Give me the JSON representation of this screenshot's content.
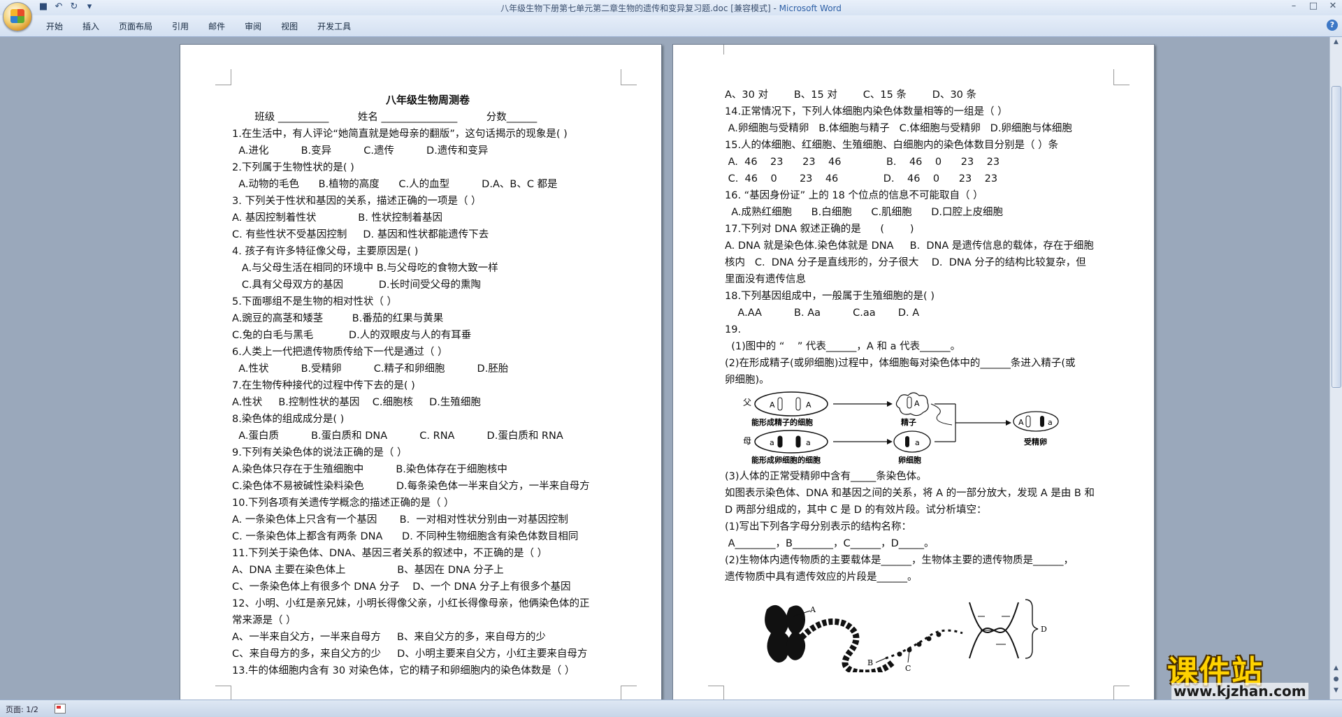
{
  "window": {
    "title": "八年级生物下册第七单元第二章生物的遗传和变异复习题.doc [兼容模式]",
    "title_sep": " - ",
    "app_name": "Microsoft Word"
  },
  "ribbon": {
    "tabs": [
      "开始",
      "插入",
      "页面布局",
      "引用",
      "邮件",
      "审阅",
      "视图",
      "开发工具"
    ]
  },
  "left_page": {
    "title": "八年级生物周测卷",
    "lines": [
      "       班级 __________         姓名 _______________         分数______",
      "1.在生活中，有人评论“她简直就是她母亲的翻版”，这句话揭示的现象是(      )",
      "  A.进化          B.变异          C.遗传          D.遗传和变异",
      "2.下列属于生物性状的是(      )",
      "  A.动物的毛色      B.植物的高度      C.人的血型          D.A、B、C 都是",
      "3. 下列关于性状和基因的关系，描述正确的一项是（   ）",
      "A. 基因控制着性状             B. 性状控制着基因",
      "C. 有些性状不受基因控制     D. 基因和性状都能遗传下去",
      "4. 孩子有许多特征像父母，主要原因是(      )",
      "   A.与父母生活在相同的环境中 B.与父母吃的食物大致一样",
      "   C.具有父母双方的基因           D.长时间受父母的熏陶",
      "5.下面哪组不是生物的相对性状（      ）",
      "A.豌豆的高茎和矮茎         B.番茄的红果与黄果",
      "C.兔的白毛与黑毛           D.人的双眼皮与人的有耳垂",
      "6.人类上一代把遗传物质传给下一代是通过（        ）",
      "  A.性状          B.受精卵          C.精子和卵细胞          D.胚胎",
      "7.在生物传种接代的过程中传下去的是(      )",
      "A.性状     B.控制性状的基因    C.细胞核     D.生殖细胞",
      "8.染色体的组成成分是(      )",
      "  A.蛋白质          B.蛋白质和 DNA          C. RNA          D.蛋白质和 RNA",
      "9.下列有关染色体的说法正确的是（       ）",
      "A.染色体只存在于生殖细胞中          B.染色体存在于细胞核中",
      "C.染色体不易被碱性染料染色          D.每条染色体一半来自父方，一半来自母方",
      "10.下列各项有关遗传学概念的描述正确的是（        ）",
      "A. 一条染色体上只含有一个基因       B.  一对相对性状分别由一对基因控制",
      "C. 一条染色体上都含有两条 DNA      D. 不同种生物细胞含有染色体数目相同",
      "11.下列关于染色体、DNA、基因三者关系的叙述中，不正确的是（        ）",
      "A、DNA 主要在染色体上                B、基因在 DNA 分子上",
      "C、一条染色体上有很多个 DNA 分子    D、一个 DNA 分子上有很多个基因",
      "12、小明、小红是亲兄妹，小明长得像父亲，小红长得像母亲，他俩染色体的正",
      "常来源是（       ）",
      "A、一半来自父方，一半来自母方     B、来自父方的多，来自母方的少",
      "C、来自母方的多，来自父方的少     D、小明主要来自父方，小红主要来自母方",
      "13.牛的体细胞内含有 30 对染色体，它的精子和卵细胞内的染色体数是（        ）"
    ]
  },
  "right_page": {
    "lines_top": [
      "A、30 对        B、15 对        C、15 条        D、30 条",
      "14.正常情况下，下列人体细胞内染色体数量相等的一组是（        ）",
      " A.卵细胞与受精卵   B.体细胞与精子   C.体细胞与受精卵   D.卵细胞与体细胞",
      "15.人的体细胞、红细胞、生殖细胞、白细胞内的染色体数目分别是（      ）条",
      " A.  46    23      23    46              B.    46    0      23    23",
      " C.  46    0       23    46              D.    46    0      23    23",
      "16. “基因身份证” 上的 18 个位点的信息不可能取自（      ）",
      "  A.成熟红细胞      B.白细胞      C.肌细胞      D.口腔上皮细胞",
      "17.下列对 DNA 叙述正确的是      (        )",
      "A. DNA 就是染色体.染色体就是 DNA     B.  DNA 是遗传信息的载体，存在于细胞",
      "核内   C.  DNA 分子是直线形的，分子很大    D.  DNA 分子的结构比较复杂，但",
      "里面没有遗传信息",
      "18.下列基因组成中，一般属于生殖细胞的是(      )",
      "    A.AA          B. Aa          C.aa       D. A",
      "19.",
      "  (1)图中的 “    ” 代表______，A 和 a 代表______。",
      "(2)在形成精子(或卵细胞)过程中，体细胞每对染色体中的______条进入精子(或",
      "卵细胞)。"
    ],
    "lines_bottom": [
      "(3)人体的正常受精卵中含有_____条染色体。",
      "如图表示染色体、DNA 和基因之间的关系，将 A 的一部分放大，发现 A 是由 B 和",
      "D 两部分组成的，其中 C 是 D 的有效片段。试分析填空：",
      "(1)写出下列各字母分别表示的结构名称：",
      " A________，B________，C______，D_____。",
      "(2)生物体内遗传物质的主要载体是______，生物体主要的遗传物质是______，",
      "遗传物质中具有遗传效应的片段是______。"
    ],
    "inheritance_diagram": {
      "father_label": "父",
      "mother_label": "母",
      "sperm_cell_label": "能形成精子的细胞",
      "egg_cell_label": "能形成卵细胞的细胞",
      "sperm_label": "精子",
      "egg_label": "卵细胞",
      "zygote_label": "受精卵",
      "allele_A": "A",
      "allele_a": "a"
    },
    "chromosome_figure": {
      "label_A": "A",
      "label_B": "B",
      "label_C": "C",
      "label_D": "D"
    }
  },
  "status": {
    "page": "页面: 1/2"
  },
  "watermark": {
    "title": "课件站",
    "url": "www.kjzhan.com"
  }
}
